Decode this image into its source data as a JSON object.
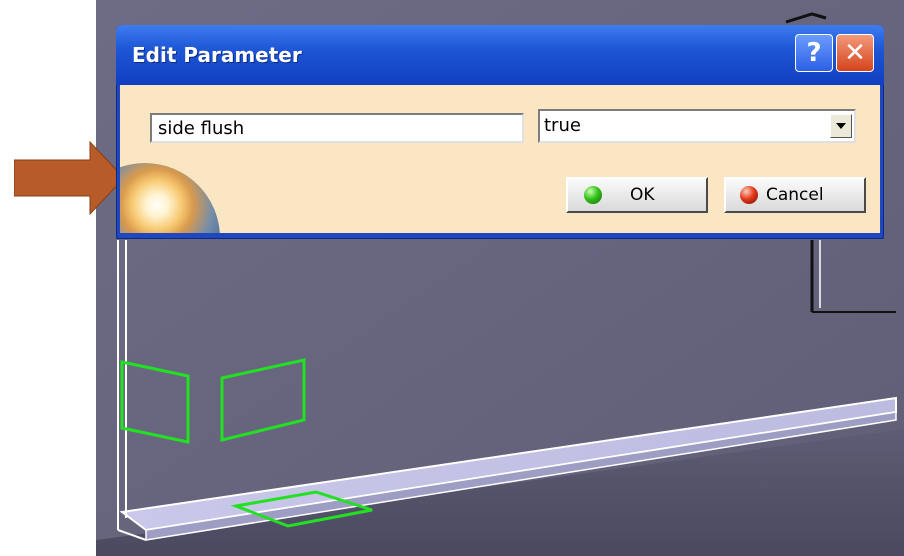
{
  "dialog": {
    "title": "Edit Parameter",
    "help_label": "?",
    "close_label": "✕",
    "parameter_name": "side flush",
    "parameter_value": "true",
    "ok_label": "OK",
    "cancel_label": "Cancel"
  },
  "icons": {
    "help": "help-icon",
    "close": "close-icon",
    "dropdown": "chevron-down-icon",
    "ok": "green-orb-icon",
    "cancel": "red-orb-icon",
    "arrow": "right-arrow-icon"
  },
  "colors": {
    "title_bar": "#1d56d6",
    "dialog_body": "#fbe6c4",
    "viewport": "#6a6a80",
    "shelf": "#c5c4e6",
    "highlight": "#22e022",
    "arrow": "#b75b28"
  }
}
